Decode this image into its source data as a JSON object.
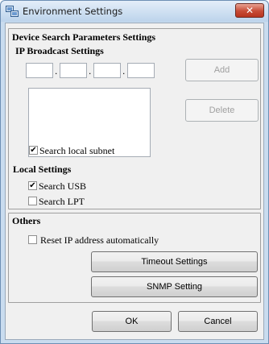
{
  "window": {
    "title": "Environment Settings",
    "close_symbol": "✕",
    "app_icon": "network-settings-icon"
  },
  "device_search": {
    "title": "Device Search Parameters Settings",
    "ip_broadcast": {
      "title": "IP Broadcast Settings",
      "octets": [
        "",
        "",
        "",
        ""
      ],
      "dot": ".",
      "add_label": "Add",
      "delete_label": "Delete",
      "list_items": []
    },
    "search_local_subnet": {
      "label": "Search local subnet",
      "checked": true
    },
    "local_settings": {
      "title": "Local Settings",
      "search_usb": {
        "label": "Search USB",
        "checked": true
      },
      "search_lpt": {
        "label": "Search LPT",
        "checked": false
      }
    }
  },
  "others": {
    "title": "Others",
    "reset_ip": {
      "label": "Reset IP address automatically",
      "checked": false
    },
    "timeout_label": "Timeout Settings",
    "snmp_label": "SNMP Setting"
  },
  "footer": {
    "ok_label": "OK",
    "cancel_label": "Cancel"
  },
  "colors": {
    "title_bar": "#c9dcef",
    "close_button": "#c74b35",
    "dialog_background": "#f0f0f0"
  }
}
